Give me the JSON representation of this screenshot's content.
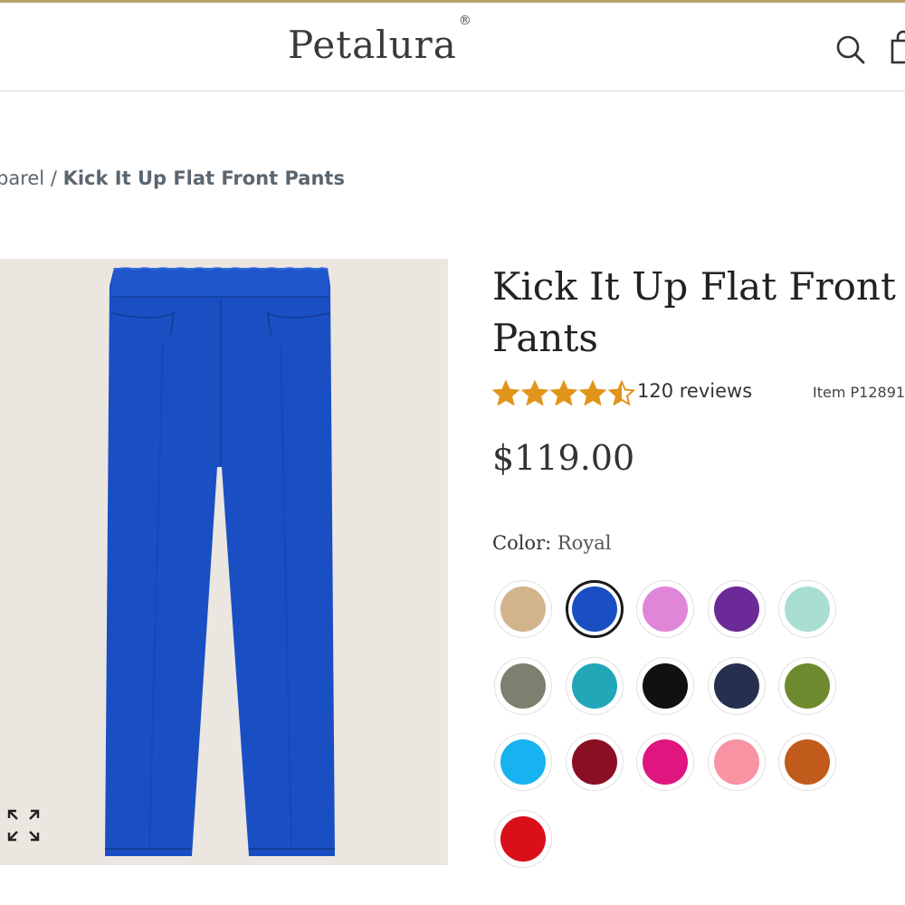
{
  "header": {
    "brand": "Petalura",
    "brand_mark": "®",
    "search_icon": "search-icon",
    "cart_icon": "shopping-bag-icon"
  },
  "breadcrumb": {
    "parent": "parel",
    "separator": " / ",
    "current": "Kick It Up Flat Front Pants"
  },
  "product": {
    "title": "Kick It Up Flat Front Pants",
    "rating": 4.5,
    "rating_max": 5,
    "reviews": "120 reviews",
    "item_number": "Item P12891",
    "price": "$119.00",
    "color_label": "Color:",
    "selected_color": "Royal",
    "zoom_icon": "expand-icon",
    "colors": {
      "accent": "#b8a06a",
      "star": "#e0951a",
      "pants": "#1a4fc4"
    }
  },
  "swatches": [
    {
      "name": "tan",
      "hex": "#d2b48c"
    },
    {
      "name": "royal",
      "hex": "#1a4fc4",
      "selected": true
    },
    {
      "name": "orchid",
      "hex": "#df86d8"
    },
    {
      "name": "purple",
      "hex": "#6c2a98"
    },
    {
      "name": "mint",
      "hex": "#a8ddd2"
    },
    {
      "name": "sage",
      "hex": "#7d806e"
    },
    {
      "name": "teal",
      "hex": "#21a7b8"
    },
    {
      "name": "black",
      "hex": "#111111"
    },
    {
      "name": "navy",
      "hex": "#26304e"
    },
    {
      "name": "olive",
      "hex": "#6e8a2e"
    },
    {
      "name": "sky",
      "hex": "#17b2ef"
    },
    {
      "name": "wine",
      "hex": "#8a0f25"
    },
    {
      "name": "magenta",
      "hex": "#e0157f"
    },
    {
      "name": "pink",
      "hex": "#f793a3"
    },
    {
      "name": "rust",
      "hex": "#c15b1c"
    },
    {
      "name": "red",
      "hex": "#d9101a"
    }
  ]
}
